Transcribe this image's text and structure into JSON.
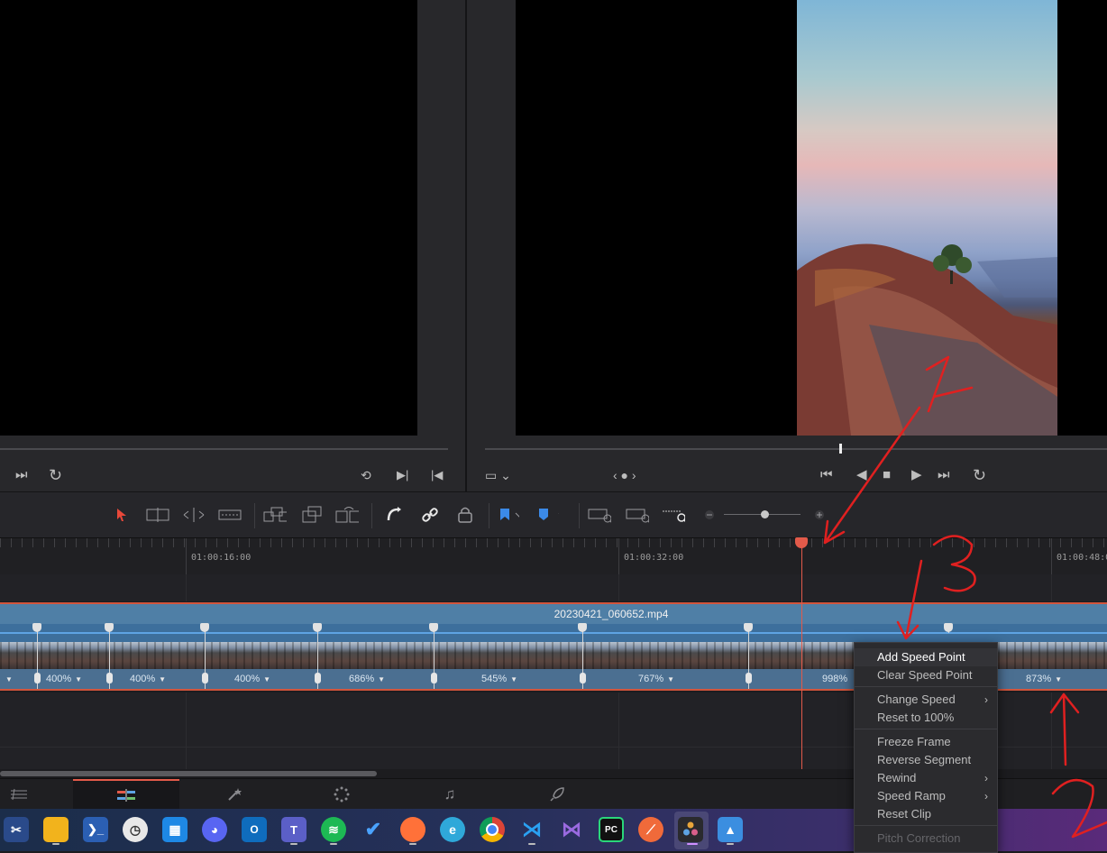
{
  "timeline": {
    "timecodes": [
      "01:00:16:00",
      "01:00:32:00",
      "01:00:48:00"
    ],
    "clip_name": "20230421_060652.mp4",
    "speed_labels": [
      "400%",
      "400%",
      "400%",
      "686%",
      "545%",
      "767%",
      "998%",
      "873%"
    ]
  },
  "context_menu": {
    "items": {
      "add_speed_point": "Add Speed Point",
      "clear_speed_point": "Clear Speed Point",
      "change_speed": "Change Speed",
      "reset_to_100": "Reset to 100%",
      "freeze_frame": "Freeze Frame",
      "reverse_segment": "Reverse Segment",
      "rewind": "Rewind",
      "speed_ramp": "Speed Ramp",
      "reset_clip": "Reset Clip",
      "pitch_correction": "Pitch Correction"
    },
    "highlighted": "Add Speed Point",
    "disabled": [
      "Pitch Correction"
    ]
  },
  "annotations": {
    "numbers": [
      "1",
      "2",
      "3"
    ],
    "color": "#e02020"
  },
  "colors": {
    "playhead": "#e25a4a",
    "clip_blue": "#4f7fa6",
    "speed_line": "#5ea3e3",
    "menu_bg": "#2b2b2e"
  },
  "icons": {
    "transport_left": [
      "skip-forward-icon",
      "loop-icon",
      "match-frame-icon",
      "mark-out-icon",
      "mark-in-icon"
    ],
    "transport_right": [
      "viewer-size-icon",
      "jump-to-start-icon",
      "play-reverse-icon",
      "stop-icon",
      "play-icon",
      "jump-to-end-icon",
      "loop-icon"
    ],
    "toolbar": [
      "selection-arrow-icon",
      "trim-edit-icon",
      "dynamic-trim-icon",
      "blade-icon",
      "insert-clip-icon",
      "overwrite-clip-icon",
      "replace-clip-icon",
      "snapping-icon",
      "linked-selection-icon",
      "position-lock-icon",
      "flag-icon",
      "marker-icon",
      "zoom-full-icon",
      "zoom-detail-icon",
      "zoom-custom-icon",
      "zoom-out-icon",
      "zoom-in-icon"
    ],
    "page_tabs": [
      "cut-page-icon",
      "edit-page-icon",
      "fusion-page-icon",
      "color-page-icon",
      "fairlight-page-icon",
      "deliver-page-icon"
    ],
    "taskbar": [
      "snipping-tool-icon",
      "file-explorer-icon",
      "powershell-icon",
      "clock-icon",
      "calendar-icon",
      "discord-icon",
      "outlook-icon",
      "teams-icon",
      "spotify-icon",
      "todo-icon",
      "firefox-icon",
      "edge-icon",
      "chrome-icon",
      "vscode-icon",
      "visual-studio-icon",
      "pycharm-icon",
      "app-orange-icon",
      "davinci-resolve-icon",
      "photos-icon"
    ]
  }
}
